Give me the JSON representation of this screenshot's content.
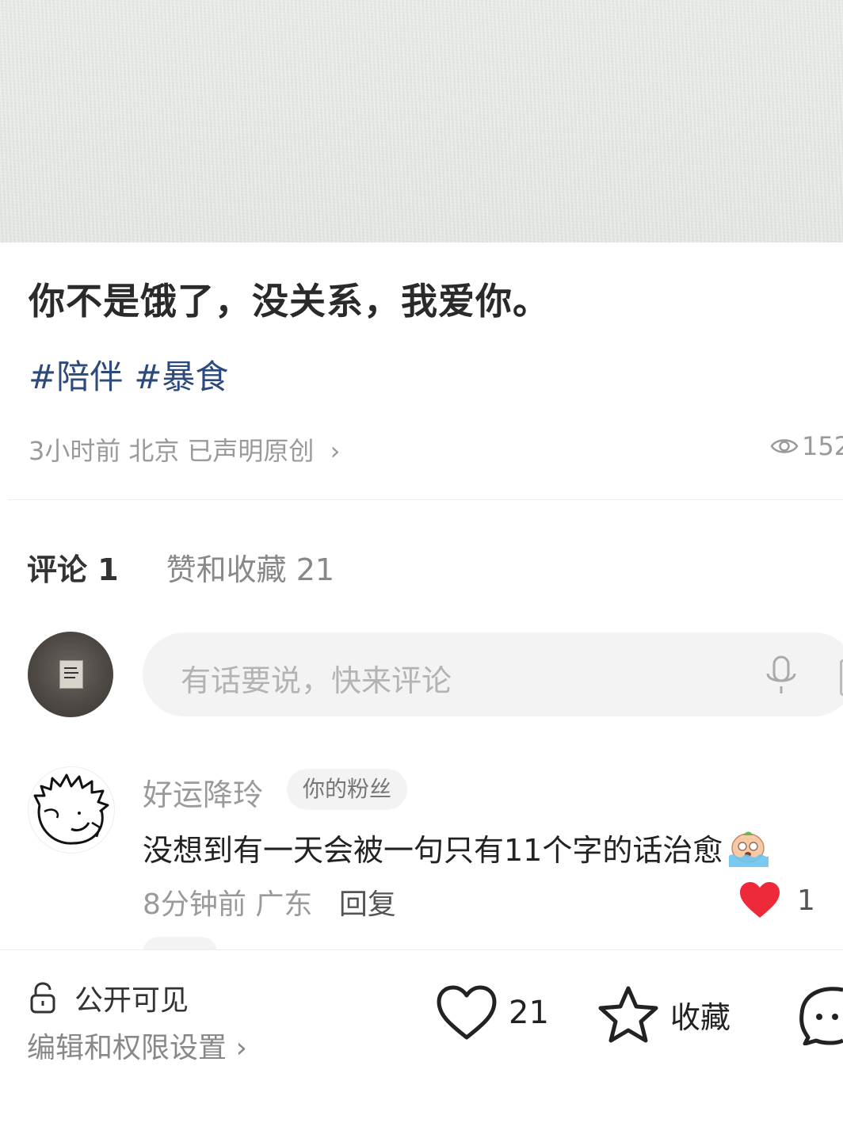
{
  "post": {
    "title": "你不是饿了，没关系，我爱你。",
    "tags": [
      "#陪伴",
      "#暴食"
    ],
    "time": "3小时前",
    "location": "北京",
    "original_label": "已声明原创",
    "views": "152"
  },
  "tabs": {
    "comments": "评论 1",
    "likes_collects": "赞和收藏 21"
  },
  "comment_input": {
    "placeholder": "有话要说，快来评论"
  },
  "comments": [
    {
      "user": "好运降玲",
      "badge": "你的粉丝",
      "text": "没想到有一天会被一句只有11个字的话治愈",
      "time": "8分钟前",
      "location": "广东",
      "reply_label": "回复",
      "likes": "1"
    }
  ],
  "bottom_bar": {
    "visibility": "公开可见",
    "edit_label": "编辑和权限设置",
    "like_count": "21",
    "collect_label": "收藏"
  },
  "colors": {
    "tag": "#2c4a7c",
    "like_red": "#ee2a3a",
    "muted": "#9a9a9a"
  }
}
